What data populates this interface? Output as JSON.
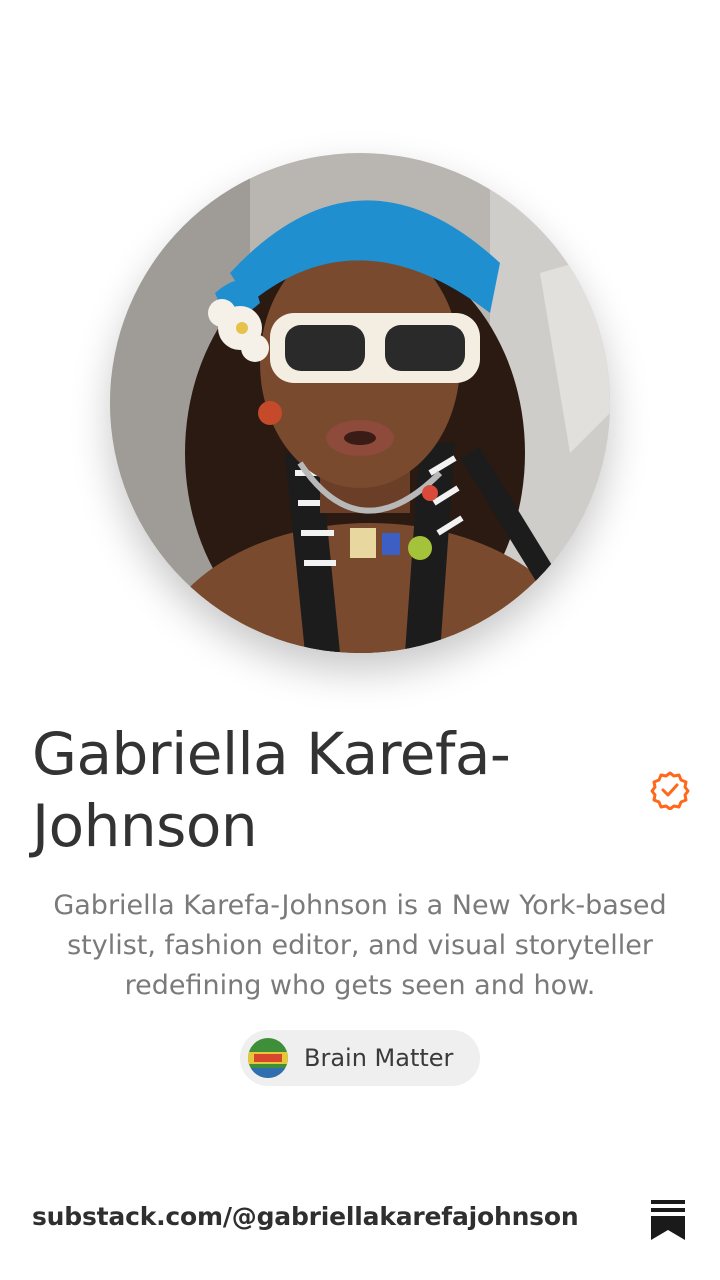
{
  "profile": {
    "name": "Gabriella Karefa-Johnson",
    "bio": "Gabriella Karefa-Johnson is a New York-based stylist, fashion editor, and visual storyteller redefining who gets seen and how.",
    "verified_icon": "verified-check-badge-icon",
    "accent_color": "#ff6719"
  },
  "publication": {
    "name": "Brain Matter",
    "logo_icon": "publication-logo-icon"
  },
  "footer": {
    "url": "substack.com/@gabriellakarefajohnson",
    "logo_icon": "substack-bookmark-icon"
  }
}
